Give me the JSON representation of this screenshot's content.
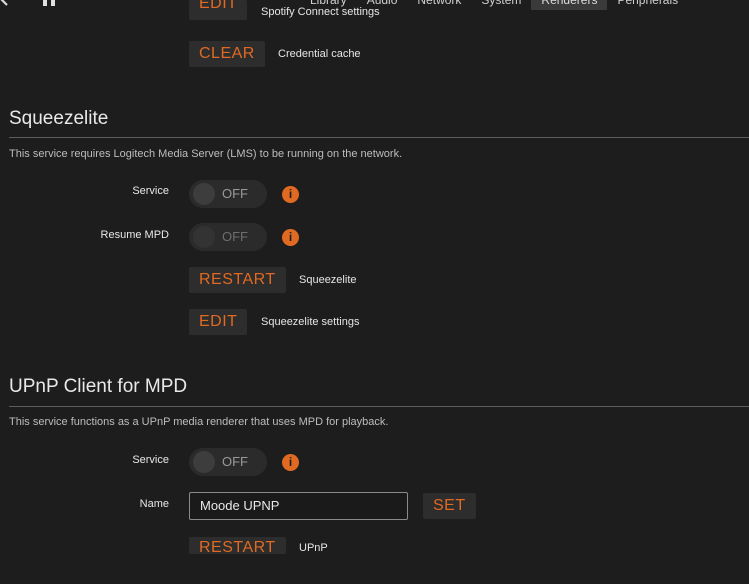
{
  "nav": {
    "tabs": [
      {
        "label": "Library"
      },
      {
        "label": "Audio"
      },
      {
        "label": "Network"
      },
      {
        "label": "System"
      },
      {
        "label": "Renderers"
      },
      {
        "label": "Peripherals"
      }
    ]
  },
  "spotify": {
    "edit_label": "EDIT",
    "edit_desc": "Spotify Connect settings",
    "clear_label": "CLEAR",
    "clear_desc": "Credential cache"
  },
  "squeezelite": {
    "title": "Squeezelite",
    "description": "This service requires Logitech Media Server (LMS) to be running on the network.",
    "service_label": "Service",
    "service_state": "OFF",
    "resume_label": "Resume MPD",
    "resume_state": "OFF",
    "restart_label": "RESTART",
    "restart_desc": "Squeezelite",
    "edit_label": "EDIT",
    "edit_desc": "Squeezelite settings"
  },
  "upnp": {
    "title": "UPnP Client for MPD",
    "description": "This service functions as a UPnP media renderer that uses MPD for playback.",
    "service_label": "Service",
    "service_state": "OFF",
    "name_label": "Name",
    "name_value": "Moode UPNP",
    "set_label": "SET",
    "restart_label": "RESTART",
    "restart_desc": "UPnP"
  },
  "colors": {
    "accent": "#e06a22",
    "background": "#1d1d1d"
  }
}
